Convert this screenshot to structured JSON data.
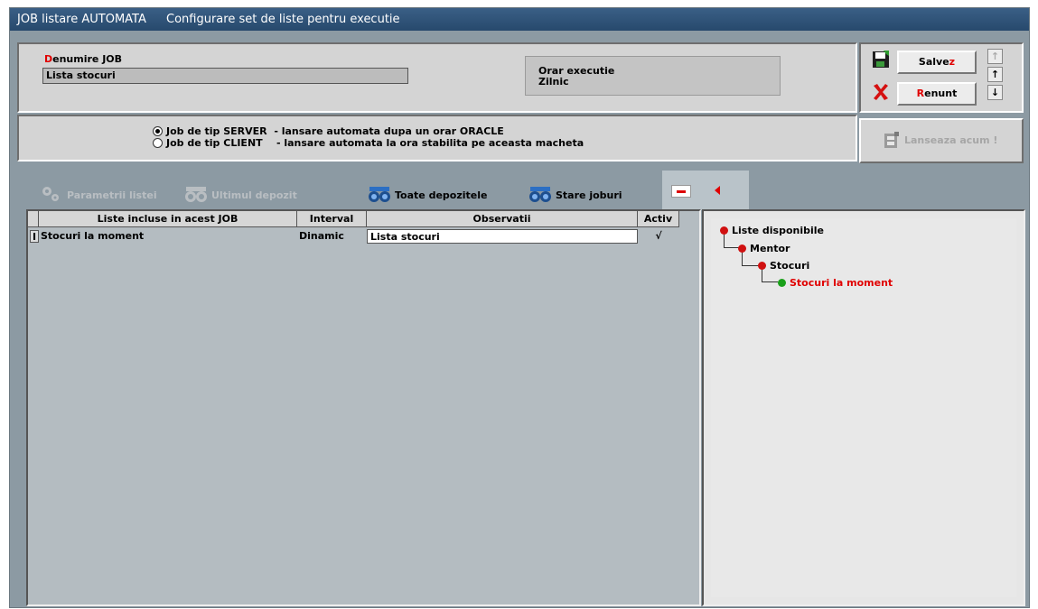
{
  "title": {
    "app": "JOB listare AUTOMATA",
    "subtitle": "Configurare set de liste pentru executie"
  },
  "job": {
    "label_first": "D",
    "label_rest": "enumire JOB",
    "value": "Lista stocuri",
    "schedule_title": "Orar executie",
    "schedule_value": "Zilnic"
  },
  "actions": {
    "save": {
      "main": "Salve",
      "hot": "z"
    },
    "cancel": {
      "hot": "R",
      "main": "enunt"
    },
    "launch": "Lanseaza acum !"
  },
  "job_type": {
    "server": "Job de tip SERVER  - lansare automata dupa un orar ORACLE",
    "client": "Job de tip CLIENT    - lansare automata la ora stabilita pe aceasta macheta",
    "selected": "server"
  },
  "toolbar": {
    "params": "Parametrii listei",
    "last_deposit": "Ultimul depozit",
    "all_deposits": "Toate depozitele",
    "job_status": "Stare joburi"
  },
  "grid": {
    "columns": [
      "Liste incluse in acest JOB",
      "Interval",
      "Observatii",
      "Activ"
    ],
    "rows": [
      {
        "marker": "I",
        "name": "Stocuri  la moment",
        "interval": "Dinamic",
        "obs": "Lista stocuri",
        "active": "√"
      }
    ]
  },
  "tree": {
    "root": "Liste disponibile",
    "level1": "Mentor",
    "level2": "Stocuri",
    "level3": "Stocuri  la moment"
  },
  "colors": {
    "title_bar": "#27496d",
    "highlight_text": "#e00000",
    "window_bg": "#8c9aa3",
    "node_red": "#d01010",
    "node_green": "#1aa01a"
  }
}
